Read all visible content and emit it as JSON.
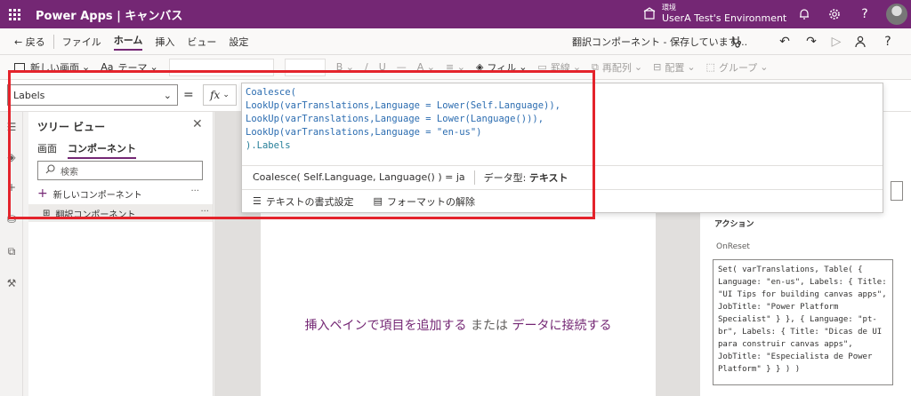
{
  "titlebar": {
    "app_name": "Power Apps | キャンバス",
    "env_label": "環境",
    "env_name": "UserA Test's Environment"
  },
  "menu": {
    "back": "← 戻る",
    "file": "ファイル",
    "home": "ホーム",
    "insert": "挿入",
    "view": "ビュー",
    "settings": "設定",
    "save_status": "翻訳コンポーネント - 保存しています..."
  },
  "ribbon": {
    "new_screen": "新しい画面",
    "theme": "テーマ",
    "fill": "フィル",
    "border": "罫線",
    "reorder": "再配列",
    "align": "配置",
    "group": "グループ"
  },
  "formula_bar": {
    "property": "Labels",
    "equals": "=",
    "fx": "fx"
  },
  "formula": {
    "lines": [
      "Coalesce(",
      "LookUp(varTranslations,Language = Lower(Self.Language)),",
      "LookUp(varTranslations,Language = Lower(Language())),",
      "LookUp(varTranslations,Language = \"en-us\")",
      ").Labels"
    ],
    "result_expr": "Coalesce( Self.Language, Language() ) = ja",
    "data_type_label": "データ型:",
    "data_type_value": "テキスト",
    "format_text": "テキストの書式設定",
    "remove_format": "フォーマットの解除"
  },
  "tree_view": {
    "title": "ツリー ビュー",
    "tabs": [
      "画面",
      "コンポーネント"
    ],
    "active_tab": 1,
    "search_placeholder": "検索",
    "new_component": "新しいコンポーネント",
    "items": [
      "翻訳コンポーネント"
    ],
    "more": "···"
  },
  "canvas": {
    "msg_part1": "挿入ペインで項目を追加する",
    "msg_part2": "または",
    "msg_part3": "データに接続する"
  },
  "properties": {
    "actions_label": "アクション",
    "onreset_label": "OnReset",
    "onreset_code": "Set( varTranslations, Table( {\nLanguage: \"en-us\", Labels: { Title:\n\"UI Tips for building canvas apps\",\nJobTitle: \"Power Platform\nSpecialist\" } }, { Language: \"pt-\nbr\", Labels: { Title: \"Dicas de UI\npara construir canvas apps\",\nJobTitle: \"Especialista de Power\nPlatform\" } } ) )"
  },
  "colors": {
    "brand": "#742774",
    "highlight": "#e4232b"
  },
  "icons": [
    "waffle-icon",
    "environment-icon",
    "bell-icon",
    "gear-icon",
    "help-icon",
    "stethoscope-icon",
    "undo-icon",
    "redo-icon",
    "play-icon",
    "person-icon",
    "close-icon",
    "search-icon",
    "plus-icon",
    "component-icon"
  ]
}
